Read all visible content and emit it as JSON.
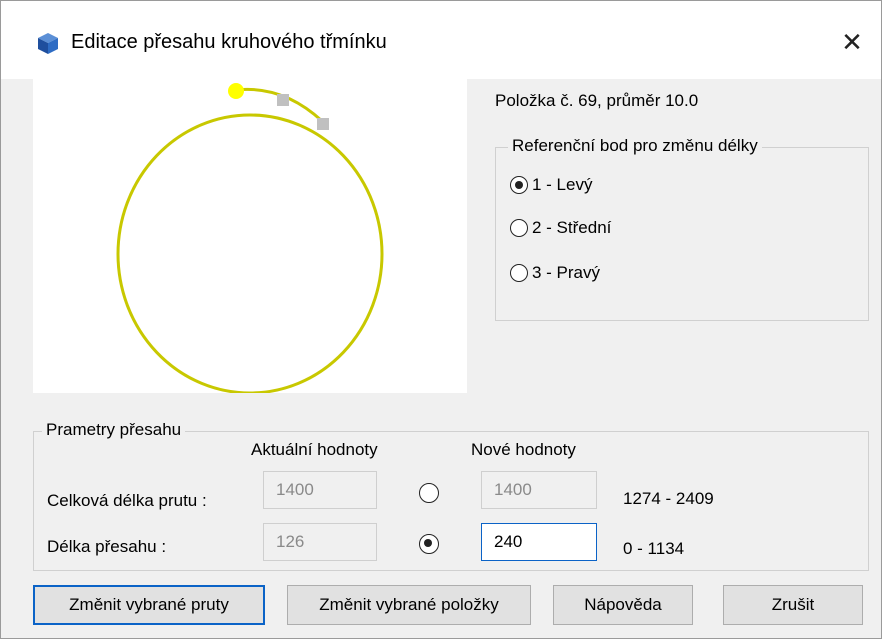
{
  "window": {
    "title": "Editace přesahu kruhového třmínku"
  },
  "info": {
    "text": "Položka č. 69, průměr 10.0"
  },
  "reference": {
    "legend": "Referenční bod pro změnu délky",
    "options": [
      {
        "label": "1 - Levý",
        "checked": true
      },
      {
        "label": "2 - Střední",
        "checked": false
      },
      {
        "label": "3 - Pravý",
        "checked": false
      }
    ]
  },
  "params": {
    "legend": "Prametry přesahu",
    "col_current": "Aktuální hodnoty",
    "col_new": "Nové hodnoty",
    "rows": [
      {
        "label": "Celková délka prutu :",
        "current": "1400",
        "new": "1400",
        "range": "1274 - 2409",
        "selected": false
      },
      {
        "label": "Délka přesahu :",
        "current": "126",
        "new": "240",
        "range": "0 - 1134",
        "selected": true
      }
    ]
  },
  "buttons": {
    "change_bars": "Změnit vybrané pruty",
    "change_items": "Změnit vybrané položky",
    "help": "Nápověda",
    "cancel": "Zrušit"
  },
  "preview": {
    "stroke_color": "#c8c800",
    "marker_color": "#ffff00",
    "point_color": "#c0c0c0"
  }
}
